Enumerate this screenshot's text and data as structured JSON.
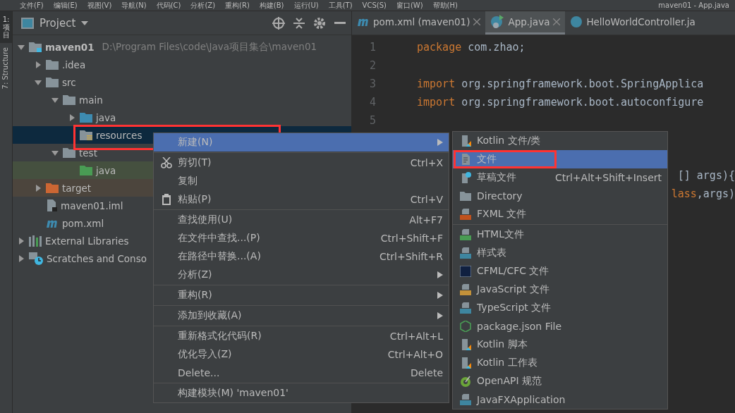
{
  "menubar": {
    "items": [
      "文件(F)",
      "编辑(E)",
      "视图(V)",
      "导航(N)",
      "代码(C)",
      "分析(Z)",
      "重构(R)",
      "构建(B)",
      "运行(U)",
      "工具(T)",
      "VCS(S)",
      "窗口(W)",
      "帮助(H)"
    ],
    "title": "maven01 - App.java"
  },
  "tool_strip": [
    {
      "label": "1: 项目",
      "selected": true
    },
    {
      "label": "7: Structure",
      "selected": false
    }
  ],
  "project": {
    "title": "Project",
    "tree": [
      {
        "label": "maven01",
        "kind": "module",
        "path": "D:\\Program Files\\code\\Java项目集合\\maven01",
        "expanded": true,
        "selected": false,
        "children": [
          {
            "label": ".idea",
            "kind": "folder",
            "expanded": false,
            "selected": false
          },
          {
            "label": "src",
            "kind": "folder",
            "expanded": true,
            "selected": false,
            "children": [
              {
                "label": "main",
                "kind": "folder",
                "expanded": true,
                "selected": false,
                "children": [
                  {
                    "label": "java",
                    "kind": "source",
                    "expanded": false,
                    "selected": false
                  },
                  {
                    "label": "resources",
                    "kind": "resources",
                    "selected": true
                  }
                ]
              },
              {
                "label": "test",
                "kind": "folder",
                "expanded": true,
                "selected": false,
                "children": [
                  {
                    "label": "java",
                    "kind": "test",
                    "selected": false
                  }
                ]
              }
            ]
          },
          {
            "label": "target",
            "kind": "excluded",
            "expanded": false,
            "selected": false
          },
          {
            "label": "maven01.iml",
            "kind": "iml",
            "selected": false
          },
          {
            "label": "pom.xml",
            "kind": "pom",
            "selected": false
          }
        ]
      },
      {
        "label": "External Libraries",
        "kind": "libraries",
        "expanded": false,
        "selected": false
      },
      {
        "label": "Scratches and Conso",
        "kind": "scratches",
        "expanded": false,
        "selected": false
      }
    ]
  },
  "editor": {
    "tabs": [
      {
        "label": "pom.xml (maven01)",
        "kind": "maven",
        "selected": false
      },
      {
        "label": "App.java",
        "kind": "run-class",
        "selected": true
      },
      {
        "label": "HelloWorldController.ja",
        "kind": "class",
        "selected": false
      }
    ],
    "lines": [
      {
        "number": "1",
        "kind": "full",
        "keyword": "package",
        "text": " com.zhao;"
      },
      {
        "number": "2",
        "kind": "full"
      },
      {
        "number": "3",
        "kind": "full",
        "keyword": "import",
        "text": " org.springframework.boot.SpringApplica"
      },
      {
        "number": "4",
        "kind": "full",
        "keyword": "import",
        "text": " org.springframework.boot.autoconfigure"
      },
      {
        "number": "5",
        "kind": "full"
      },
      {
        "kind": "covered"
      },
      {
        "kind": "covered"
      },
      {
        "kind": "fragment",
        "text": "[] args){"
      },
      {
        "kind": "fragment",
        "keyword": "lass",
        "text": ",args)"
      }
    ]
  },
  "context_menu": {
    "items": [
      {
        "label": "新建(N)",
        "kind": "submenu",
        "selected": true
      },
      {
        "kind": "separator"
      },
      {
        "label": "剪切(T)",
        "kind": "item",
        "shortcut": "Ctrl+X",
        "selected": false
      },
      {
        "label": "复制",
        "kind": "item",
        "selected": false
      },
      {
        "label": "粘贴(P)",
        "kind": "item",
        "shortcut": "Ctrl+V",
        "selected": false
      },
      {
        "kind": "separator"
      },
      {
        "label": "查找使用(U)",
        "kind": "item",
        "shortcut": "Alt+F7",
        "selected": false
      },
      {
        "label": "在文件中查找...(P)",
        "kind": "item",
        "shortcut": "Ctrl+Shift+F",
        "selected": false
      },
      {
        "label": "在路径中替换...(A)",
        "kind": "item",
        "shortcut": "Ctrl+Shift+R",
        "selected": false
      },
      {
        "label": "分析(Z)",
        "kind": "submenu",
        "selected": false
      },
      {
        "kind": "separator"
      },
      {
        "label": "重构(R)",
        "kind": "submenu",
        "selected": false
      },
      {
        "kind": "separator"
      },
      {
        "label": "添加到收藏(A)",
        "kind": "submenu",
        "selected": false
      },
      {
        "kind": "separator"
      },
      {
        "label": "重新格式化代码(R)",
        "kind": "item",
        "shortcut": "Ctrl+Alt+L",
        "selected": false
      },
      {
        "label": "优化导入(Z)",
        "kind": "item",
        "shortcut": "Ctrl+Alt+O",
        "selected": false
      },
      {
        "label": "Delete...",
        "kind": "item",
        "shortcut": "Delete",
        "selected": false
      },
      {
        "kind": "separator"
      },
      {
        "label": "构建模块(M) 'maven01'",
        "kind": "item",
        "selected": false
      }
    ]
  },
  "submenu": {
    "items": [
      {
        "label": "Kotlin 文件/类",
        "kind": "kotlin",
        "selected": false
      },
      {
        "label": "文件",
        "kind": "file",
        "selected": true
      },
      {
        "label": "草稿文件",
        "kind": "scratch",
        "shortcut": "Ctrl+Alt+Shift+Insert",
        "selected": false
      },
      {
        "label": "Directory",
        "kind": "folder",
        "selected": false
      },
      {
        "label": "FXML 文件",
        "kind": "fxml",
        "selected": false
      },
      {
        "kind": "separator"
      },
      {
        "label": "HTML文件",
        "kind": "html",
        "selected": false
      },
      {
        "label": "样式表",
        "kind": "css",
        "selected": false
      },
      {
        "label": "CFML/CFC 文件",
        "kind": "cfml",
        "selected": false
      },
      {
        "label": "JavaScript 文件",
        "kind": "js",
        "selected": false
      },
      {
        "label": "TypeScript 文件",
        "kind": "ts",
        "selected": false
      },
      {
        "label": "package.json File",
        "kind": "node",
        "selected": false
      },
      {
        "label": "Kotlin 脚本",
        "kind": "kotlin",
        "selected": false
      },
      {
        "label": "Kotlin 工作表",
        "kind": "kotlin",
        "selected": false
      },
      {
        "label": "OpenAPI 规范",
        "kind": "openapi",
        "selected": false
      },
      {
        "label": "JavaFXApplication",
        "kind": "javafx",
        "selected": false
      }
    ]
  }
}
